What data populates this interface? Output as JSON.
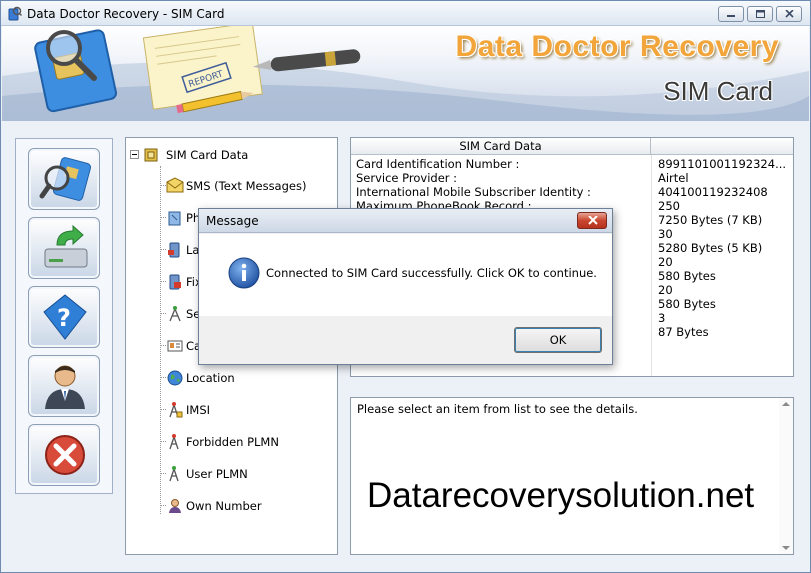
{
  "window": {
    "title": "Data Doctor Recovery - SIM Card"
  },
  "banner": {
    "brand_title": "Data Doctor Recovery",
    "brand_subtitle": "SIM Card",
    "report_stamp": "REPORT"
  },
  "toolbar": {
    "buttons": [
      {
        "icon": "sim-search-icon"
      },
      {
        "icon": "save-drive-icon"
      },
      {
        "icon": "help-icon"
      },
      {
        "icon": "about-user-icon"
      },
      {
        "icon": "exit-icon"
      }
    ]
  },
  "tree": {
    "root_label": "SIM Card Data",
    "items": [
      {
        "label": "SMS (Text Messages)",
        "icon": "envelope-icon"
      },
      {
        "label": "Ph",
        "icon": "phonebook-icon"
      },
      {
        "label": "La",
        "icon": "last-dialed-icon"
      },
      {
        "label": "Fix",
        "icon": "fixed-dialing-icon"
      },
      {
        "label": "Se",
        "icon": "service-antenna-icon"
      },
      {
        "label": "Ca",
        "icon": "card-icon"
      },
      {
        "label": "Location",
        "icon": "globe-icon"
      },
      {
        "label": "IMSI",
        "icon": "antenna-icon"
      },
      {
        "label": "Forbidden PLMN",
        "icon": "antenna-icon"
      },
      {
        "label": "User PLMN",
        "icon": "antenna-icon"
      },
      {
        "label": "Own Number",
        "icon": "user-icon"
      }
    ]
  },
  "grid": {
    "header": "SIM Card Data",
    "rows": [
      {
        "name": "Card Identification Number :",
        "value": "8991101001192324..."
      },
      {
        "name": "Service Provider :",
        "value": "Airtel"
      },
      {
        "name": "International Mobile Subscriber Identity :",
        "value": "404100119232408"
      },
      {
        "name": "Maximum PhoneBook Record :",
        "value": "250"
      },
      {
        "name": "",
        "value": "7250 Bytes (7 KB)"
      },
      {
        "name": "",
        "value": "30"
      },
      {
        "name": "",
        "value": "5280 Bytes (5 KB)"
      },
      {
        "name": "",
        "value": "20"
      },
      {
        "name": "",
        "value": "580 Bytes"
      },
      {
        "name": "",
        "value": "20"
      },
      {
        "name": "",
        "value": "580 Bytes"
      },
      {
        "name": "",
        "value": "3"
      },
      {
        "name": "",
        "value": "87 Bytes"
      }
    ]
  },
  "details": {
    "hint": "Please select an item from list to see the details.",
    "watermark": "Datarecoverysolution.net"
  },
  "dialog": {
    "title": "Message",
    "message": "Connected to SIM Card successfully. Click OK to continue.",
    "ok_label": "OK"
  },
  "colors": {
    "brand_orange": "#f2a53b",
    "window_border": "#6d8bb0",
    "close_red": "#c9472f"
  }
}
